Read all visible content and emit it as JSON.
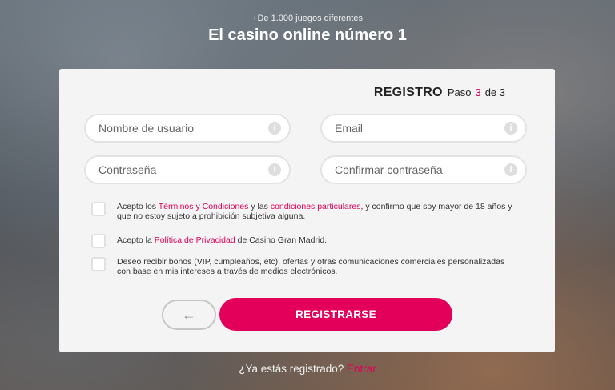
{
  "hero": {
    "subtitle": "+De 1.000 juegos diferentes",
    "title": "El casino online número 1"
  },
  "form": {
    "step_title": "REGISTRO",
    "step_word": "Paso",
    "step_current": "3",
    "step_of": "de 3",
    "fields": {
      "username_placeholder": "Nombre de usuario",
      "email_placeholder": "Email",
      "password_placeholder": "Contraseña",
      "confirm_password_placeholder": "Confirmar contraseña",
      "info_glyph": "i"
    },
    "consents": {
      "terms": {
        "prefix": "Acepto los ",
        "link1": "Términos y Condiciones",
        "mid": " y las ",
        "link2": "condiciones particulares",
        "suffix": ", y confirmo que soy mayor de 18 años y que no estoy sujeto a prohibición subjetiva alguna."
      },
      "privacy": {
        "prefix": "Acepto la ",
        "link": "Política de Privacidad",
        "suffix": " de Casino Gran Madrid."
      },
      "marketing": {
        "text": "Deseo recibir bonos (VIP, cumpleaños, etc), ofertas y otras comunicaciones comerciales personalizadas con base en mis intereses a través de medios electrónicos."
      }
    },
    "back_glyph": "←",
    "register_label": "REGISTRARSE"
  },
  "footer": {
    "question": "¿Ya estás registrado? ",
    "login_link": "Entrar"
  },
  "colors": {
    "accent": "#e3005b",
    "card_bg": "#f4f4f4"
  }
}
